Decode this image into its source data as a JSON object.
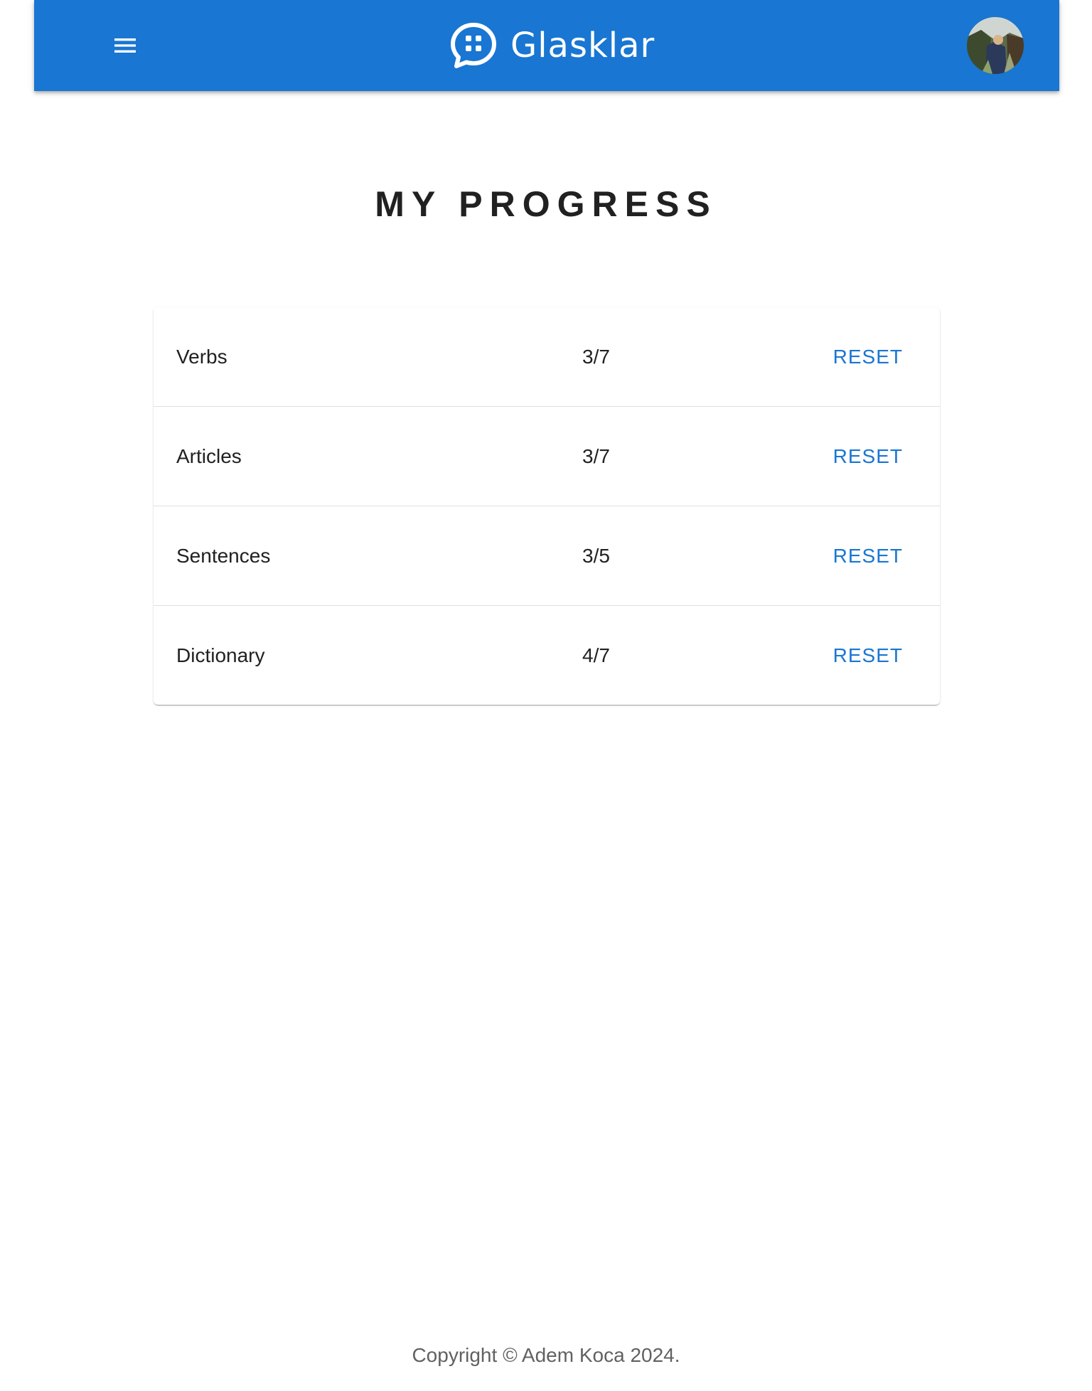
{
  "header": {
    "brand_title": "Glasklar",
    "menu_icon": "hamburger-menu-icon",
    "logo_icon": "chat-bubble-logo-icon",
    "avatar": "user-avatar",
    "background_color": "#1976d2"
  },
  "page": {
    "title": "MY PROGRESS"
  },
  "progress": {
    "rows": [
      {
        "label": "Verbs",
        "score": "3/7",
        "reset_label": "RESET"
      },
      {
        "label": "Articles",
        "score": "3/7",
        "reset_label": "RESET"
      },
      {
        "label": "Sentences",
        "score": "3/5",
        "reset_label": "RESET"
      },
      {
        "label": "Dictionary",
        "score": "4/7",
        "reset_label": "RESET"
      }
    ],
    "accent_color": "#1976d2"
  },
  "footer": {
    "copyright": "Copyright © Adem Koca 2024."
  }
}
